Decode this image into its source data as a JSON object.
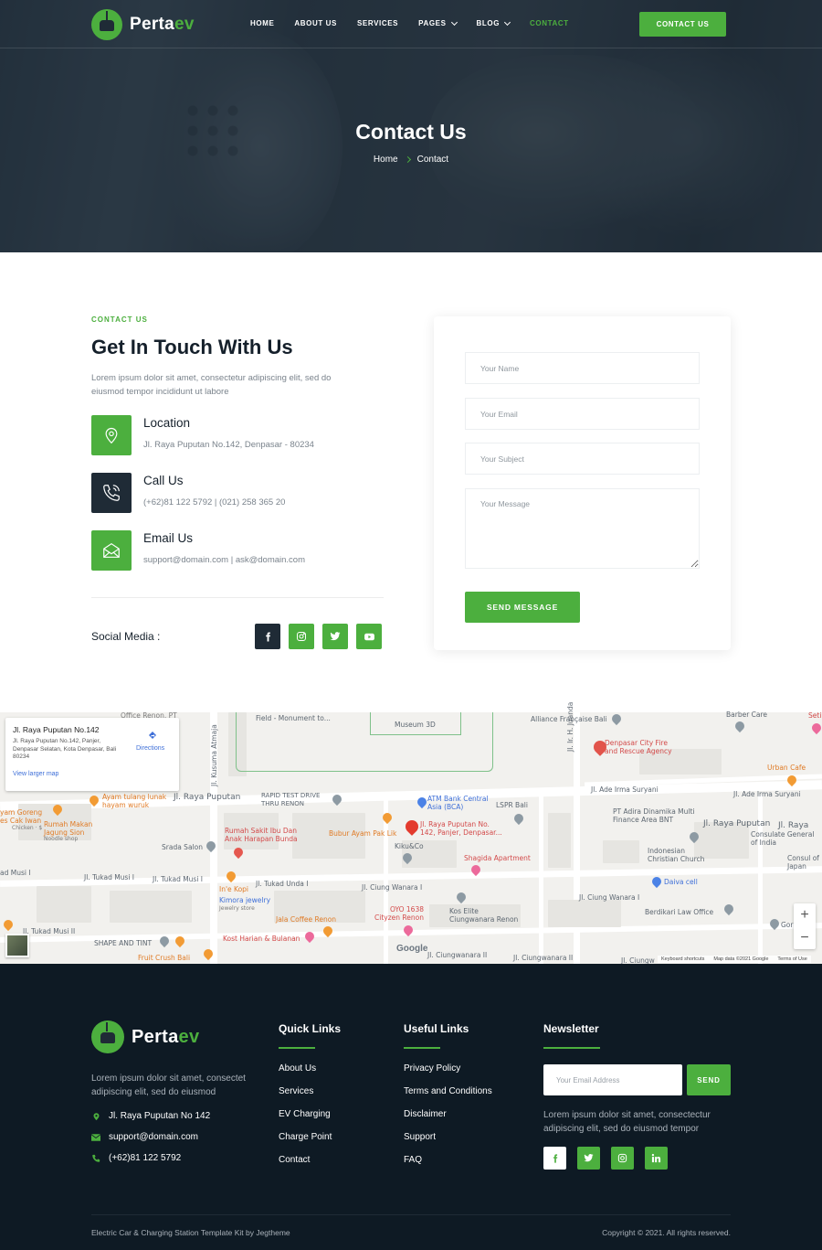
{
  "brand": {
    "name_main": "Perta",
    "name_accent": "ev",
    "accent_color": "#4caf3e",
    "dark_color": "#1f2b36"
  },
  "nav": {
    "items": [
      {
        "label": "Home",
        "dropdown": false,
        "active": false
      },
      {
        "label": "About Us",
        "dropdown": false,
        "active": false
      },
      {
        "label": "Services",
        "dropdown": false,
        "active": false
      },
      {
        "label": "Pages",
        "dropdown": true,
        "active": false
      },
      {
        "label": "Blog",
        "dropdown": true,
        "active": false
      },
      {
        "label": "Contact",
        "dropdown": false,
        "active": true
      }
    ],
    "cta_label": "CONTACT US"
  },
  "hero": {
    "title": "Contact Us",
    "breadcrumb": [
      "Home",
      "Contact"
    ]
  },
  "contact": {
    "eyebrow": "CONTACT US",
    "title": "Get In Touch With Us",
    "description": "Lorem ipsum dolor sit amet, consectetur adipiscing elit, sed do eiusmod tempor incididunt ut labore",
    "items": [
      {
        "title": "Location",
        "text": "Jl. Raya Puputan No.142, Denpasar - 80234",
        "icon": "location-icon"
      },
      {
        "title": "Call Us",
        "text": "(+62)81 122 5792 | (021) 258 365 20",
        "icon": "phone-icon"
      },
      {
        "title": "Email Us",
        "text": "support@domain.com | ask@domain.com",
        "icon": "envelope-icon"
      }
    ],
    "social_label": "Social Media :",
    "social": [
      "facebook-icon",
      "instagram-icon",
      "twitter-icon",
      "youtube-icon"
    ]
  },
  "form": {
    "name_placeholder": "Your Name",
    "email_placeholder": "Your Email",
    "subject_placeholder": "Your Subject",
    "message_placeholder": "Your Message",
    "submit_label": "SEND MESSAGE"
  },
  "map": {
    "info_title": "Jl. Raya Puputan No.142",
    "info_address": "Jl. Raya Puputan No.142, Panjer, Denpasar Selatan, Kota Denpasar, Bali 80234",
    "info_link": "View larger map",
    "directions": "Directions",
    "labels": {
      "office": "Office Renon, PT",
      "field": "Field - Monument to...",
      "museum": "Museum 3D",
      "alliance": "Alliance Française Bali",
      "barber": "Barber Care",
      "seti": "Seti",
      "fire": "Denpasar City Fire and Rescue Agency",
      "urban": "Urban Cafe",
      "ade1": "Jl. Ade Irma Suryani",
      "ade2": "Jl. Ade Irma Suryani",
      "juanda": "Jl. Ir. H. Juanda",
      "kusuma": "Jl. Kusuma Atmaja",
      "tulang": "Ayam tulang lunak hayam wuruk",
      "puputan1": "Jl. Raya Puputan",
      "rapid": "RAPID TEST DRIVE THRU RENON",
      "atm": "ATM Bank Central Asia (BCA)",
      "lspr": "LSPR Bali",
      "pt": "PT Adira Dinamika Multi Finance Area BNT",
      "puputan2": "Jl. Raya Puputan",
      "raya": "Jl. Raya",
      "ayamgoreng": "yam Goreng es Cak Iwan",
      "chicken": "Chicken · $",
      "rumahmakan": "Rumah Makan Jagung Sion",
      "noodle": "Noodle shop",
      "rumahsakit": "Rumah Sakit Ibu Dan Anak Harapan Bunda",
      "bubur": "Bubur Ayam Pak Lik",
      "target": "Jl. Raya Puputan No. 142, Panjer, Denpasar...",
      "kiku": "Kiku&Co",
      "consulate": "Consulate General of India",
      "consul": "Consul of Japan",
      "church": "Indonesian Christian Church",
      "srada": "Srada Salon",
      "shagida": "Shagida Apartment",
      "daiva": "Daiva cell",
      "adimusi": "ad Musi I",
      "tukadmusi1": "Jl. Tukad Musi I",
      "tukadmusi2": "Jl. Tukad Musi I",
      "tukadunda": "Jl. Tukad Unda I",
      "ciungwanara1": "Jl. Ciung Wanara I",
      "ciungwanara2": "Jl. Ciung Wanara I",
      "inkopi": "In'e Kopi",
      "kimora": "Kimora jewelry",
      "jewelry": "Jewelry store",
      "oyo": "OYO 1638 Cityzen Renon",
      "koselite": "Kos Elite Ciungwanara Renon",
      "berdikari": "Berdikari Law Office",
      "jala": "Jala Coffee Renon",
      "gor": "Gor",
      "tukadmusi3": "Jl. Tukad Musi II",
      "shape": "SHAPE AND TINT",
      "kost": "Kost Harian & Bulanan",
      "fruit": "Fruit Crush Bali",
      "ciungwanara3": "Jl. Ciungwanara II",
      "ciungwanara4": "Jl. Ciungwanara II",
      "ciungw": "Jl. Ciungw"
    },
    "footer": [
      "Keyboard shortcuts",
      "Map data ©2021 Google",
      "Terms of Use"
    ],
    "google": "Google",
    "zoom_in": "+",
    "zoom_out": "−"
  },
  "footer": {
    "description": "Lorem ipsum dolor sit amet, consectet adipiscing elit, sed do eiusmod",
    "address": "Jl. Raya Puputan No 142",
    "email": "support@domain.com",
    "phone": "(+62)81 122 5792",
    "quick_links_title": "Quick Links",
    "quick_links": [
      "About Us",
      "Services",
      "EV Charging",
      "Charge Point",
      "Contact"
    ],
    "useful_links_title": "Useful Links",
    "useful_links": [
      "Privacy Policy",
      "Terms and Conditions",
      "Disclaimer",
      "Support",
      "FAQ"
    ],
    "newsletter_title": "Newsletter",
    "newsletter_placeholder": "Your Email Address",
    "newsletter_button": "SEND",
    "newsletter_desc": "Lorem ipsum dolor sit amet, consectectur adipiscing elit, sed do eiusmod tempor",
    "social": [
      "facebook-icon",
      "twitter-icon",
      "instagram-icon",
      "linkedin-icon"
    ],
    "credit": "Electric Car & Charging Station Template Kit by Jegtheme",
    "copyright": "Copyright © 2021. All rights reserved."
  }
}
